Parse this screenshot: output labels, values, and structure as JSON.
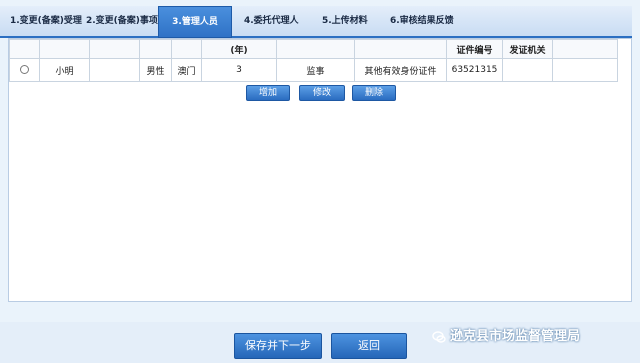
{
  "tabs": [
    {
      "label": "1.变更(备案)受理"
    },
    {
      "label": "2.变更(备案)事项"
    },
    {
      "label": "3.管理人员"
    },
    {
      "label": "4.委托代理人"
    },
    {
      "label": "5.上传材料"
    },
    {
      "label": "6.审核结果反馈"
    }
  ],
  "active_tab": "3.管理人员",
  "table": {
    "headers": [
      "",
      "",
      "",
      "",
      "",
      "(年)",
      "",
      "",
      "证件编号",
      "发证机关",
      ""
    ],
    "rows": [
      [
        "",
        "小明",
        "",
        "男性",
        "澳门",
        "3",
        "监事",
        "其他有效身份证件",
        "63521315",
        "",
        ""
      ]
    ]
  },
  "row_actions": {
    "add": "增加",
    "edit": "修改",
    "delete": "删除"
  },
  "footer": {
    "save_next": "保存并下一步",
    "back": "返回"
  },
  "watermark": "逊克县市场监督管理局"
}
